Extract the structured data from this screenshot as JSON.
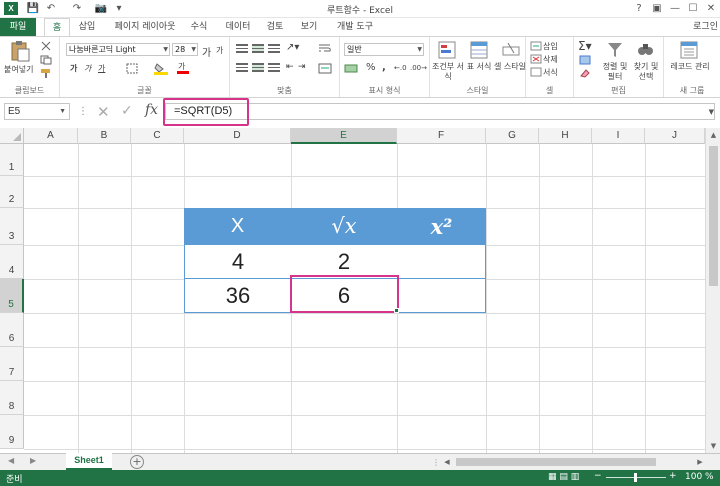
{
  "window": {
    "title": "루트함수 - Excel",
    "login": "로그인",
    "buttons": [
      "?",
      "▣",
      "—",
      "☐",
      "✕"
    ]
  },
  "qat": [
    "💾",
    "↶",
    "↷",
    "📷",
    "▾"
  ],
  "tabs": [
    "파일",
    "홈",
    "삽입",
    "페이지 레이아웃",
    "수식",
    "데이터",
    "검토",
    "보기",
    "개발 도구"
  ],
  "ribbon": {
    "clipboard": {
      "paste": "붙여넣기",
      "label": "클립보드"
    },
    "font": {
      "name": "나눔바른고딕 Light",
      "size": "28",
      "grow": "가",
      "shrink": "가",
      "bold": "가",
      "italic": "가",
      "underline": "가",
      "fontcolor": "가",
      "label": "글꼴"
    },
    "align": {
      "label": "맞춤"
    },
    "number": {
      "format": "일반",
      "percent": "%",
      "comma": ",",
      "label": "표시 형식"
    },
    "styles": {
      "cond": "조건부 서식",
      "table": "표 서식",
      "cell": "셀 스타일",
      "label": "스타일"
    },
    "cells": {
      "insert": "삽입",
      "delete": "삭제",
      "format": "서식",
      "label": "셀"
    },
    "editing": {
      "sort": "정렬 및 필터",
      "find": "찾기 및 선택",
      "label": "편집"
    },
    "newgroup": {
      "record": "레코드 관리",
      "label": "새 그룹"
    }
  },
  "formula_bar": {
    "name_box": "E5",
    "fx": "fx",
    "formula": "=SQRT(D5)"
  },
  "columns": [
    "A",
    "B",
    "C",
    "D",
    "E",
    "F",
    "G",
    "H",
    "I",
    "J"
  ],
  "rows": [
    "1",
    "2",
    "3",
    "4",
    "5",
    "6",
    "7",
    "8",
    "9"
  ],
  "table": {
    "headers": [
      "X",
      "√x",
      "x²"
    ],
    "rows": [
      [
        "4",
        "2",
        ""
      ],
      [
        "36",
        "6",
        ""
      ]
    ]
  },
  "sheets": {
    "active": "Sheet1",
    "add": "+"
  },
  "status": {
    "ready": "준비",
    "zoom": "100 %"
  },
  "colors": {
    "accent": "#217346",
    "table_header": "#5b9bd5",
    "highlight": "#d6338a"
  }
}
